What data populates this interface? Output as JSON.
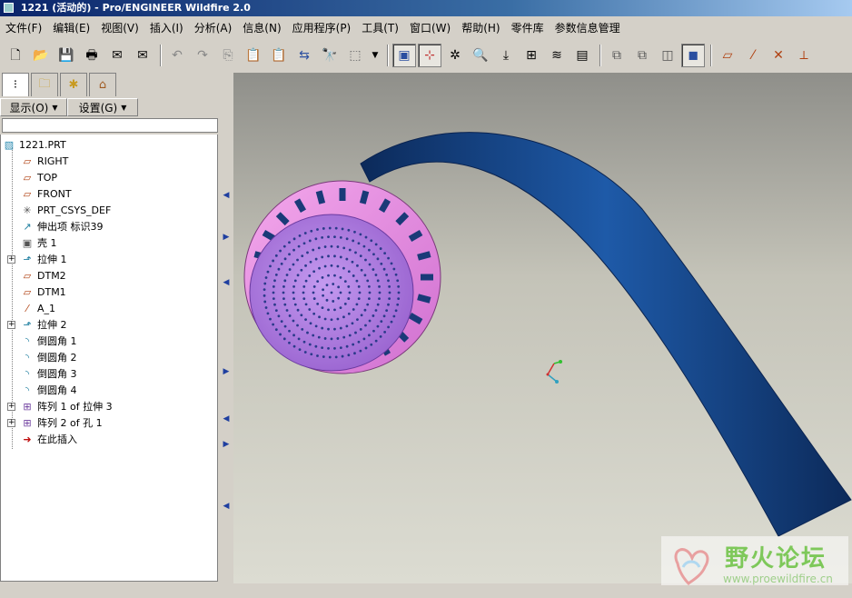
{
  "window": {
    "title": "1221 (活动的) - Pro/ENGINEER Wildfire 2.0"
  },
  "menu": [
    "文件(F)",
    "编辑(E)",
    "视图(V)",
    "插入(I)",
    "分析(A)",
    "信息(N)",
    "应用程序(P)",
    "工具(T)",
    "窗口(W)",
    "帮助(H)",
    "零件库",
    "参数信息管理"
  ],
  "toolbar": {
    "file_group": [
      "new-icon",
      "open-icon",
      "save-icon",
      "print-icon",
      "email-icon",
      "email-attach-icon"
    ],
    "edit_group": [
      "undo-icon",
      "redo-icon",
      "copy-icon",
      "paste-icon",
      "paste-special-icon",
      "regenerate-icon",
      "find-icon",
      "select-box-icon",
      "dropdown-icon"
    ],
    "view_group": [
      "repaint-icon",
      "spin-center-icon",
      "orient-icon",
      "zoom-window-icon",
      "refit-icon",
      "saved-views-icon",
      "layers-icon",
      "view-manager-icon"
    ],
    "display_group": [
      "wireframe-icon",
      "hidden-line-icon",
      "no-hidden-icon",
      "shading-icon"
    ],
    "datum_group": [
      "datum-planes-icon",
      "datum-axes-icon",
      "datum-points-icon",
      "datum-csys-icon"
    ]
  },
  "navigator": {
    "tabs": [
      "model-tree-tab",
      "folder-browser-tab",
      "favorites-tab",
      "connections-tab"
    ],
    "display_menu": "显示(O)",
    "settings_menu": "设置(G)"
  },
  "model_tree": [
    {
      "label": "1221.PRT",
      "icon": "part-icon",
      "level": 0,
      "expandable": false
    },
    {
      "label": "RIGHT",
      "icon": "datum-plane-icon",
      "level": 1,
      "expandable": false
    },
    {
      "label": "TOP",
      "icon": "datum-plane-icon",
      "level": 1,
      "expandable": false
    },
    {
      "label": "FRONT",
      "icon": "datum-plane-icon",
      "level": 1,
      "expandable": false
    },
    {
      "label": "PRT_CSYS_DEF",
      "icon": "csys-icon",
      "level": 1,
      "expandable": false
    },
    {
      "label": "伸出项 标识39",
      "icon": "sweep-icon",
      "level": 1,
      "expandable": false
    },
    {
      "label": "壳 1",
      "icon": "shell-icon",
      "level": 1,
      "expandable": false
    },
    {
      "label": "拉伸 1",
      "icon": "extrude-icon",
      "level": 1,
      "expandable": true
    },
    {
      "label": "DTM2",
      "icon": "datum-plane-icon",
      "level": 1,
      "expandable": false
    },
    {
      "label": "DTM1",
      "icon": "datum-plane-icon",
      "level": 1,
      "expandable": false
    },
    {
      "label": "A_1",
      "icon": "axis-icon",
      "level": 1,
      "expandable": false
    },
    {
      "label": "拉伸 2",
      "icon": "extrude-icon",
      "level": 1,
      "expandable": true
    },
    {
      "label": "倒圆角 1",
      "icon": "round-icon",
      "level": 1,
      "expandable": false
    },
    {
      "label": "倒圆角 2",
      "icon": "round-icon",
      "level": 1,
      "expandable": false
    },
    {
      "label": "倒圆角 3",
      "icon": "round-icon",
      "level": 1,
      "expandable": false
    },
    {
      "label": "倒圆角 4",
      "icon": "round-icon",
      "level": 1,
      "expandable": false
    },
    {
      "label": "阵列 1 of 拉伸 3",
      "icon": "pattern-icon",
      "level": 1,
      "expandable": true
    },
    {
      "label": "阵列 2 of 孔 1",
      "icon": "pattern-icon",
      "level": 1,
      "expandable": true
    },
    {
      "label": "在此插入",
      "icon": "insert-here-arrow-icon",
      "level": 1,
      "expandable": false
    }
  ],
  "colors": {
    "hose": "#1a4a8c",
    "head_face": "#b07de0",
    "head_ring": "#e88ee0",
    "viewport_bg": "#c4c3b8",
    "title_bar": "#0a246a"
  },
  "watermark": {
    "name": "野火论坛",
    "url": "www.proewildfire.cn"
  }
}
